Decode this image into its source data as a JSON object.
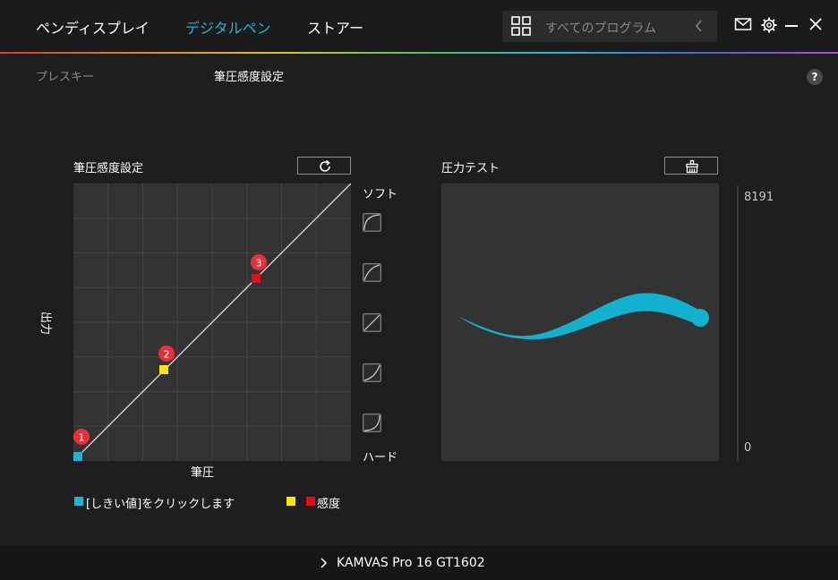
{
  "nav": {
    "tabs": [
      {
        "label": "ペンディスプレイ"
      },
      {
        "label": "デジタルペン"
      },
      {
        "label": "ストアー"
      }
    ]
  },
  "search": {
    "placeholder": "すべてのプログラム"
  },
  "subtabs": [
    {
      "label": "プレスキー"
    },
    {
      "label": "筆圧感度設定"
    }
  ],
  "help": {
    "label": "?"
  },
  "curve_panel": {
    "title": "筆圧感度設定",
    "x_label": "筆圧",
    "y_label": "出力",
    "soft_label": "ソフト",
    "hard_label": "ハード",
    "points": [
      {
        "num": "1",
        "color": "#1fb4d6"
      },
      {
        "num": "2",
        "color": "#ffe600"
      },
      {
        "num": "3",
        "color": "#e01010"
      }
    ]
  },
  "pressure_panel": {
    "title": "圧力テスト",
    "max_value": "8191",
    "min_value": "0",
    "stroke_color": "#12b1cf"
  },
  "legend": {
    "threshold_text": "[しきい値]をクリックします",
    "sensitivity_text": "感度",
    "threshold_color": "#1fb4d6",
    "sensitivity_colors": [
      "#ffe600",
      "#e01010"
    ]
  },
  "footer": {
    "device_name": "KAMVAS Pro 16 GT1602"
  },
  "colors": {
    "accent": "#1fb4d6",
    "badge": "#e8303a"
  }
}
